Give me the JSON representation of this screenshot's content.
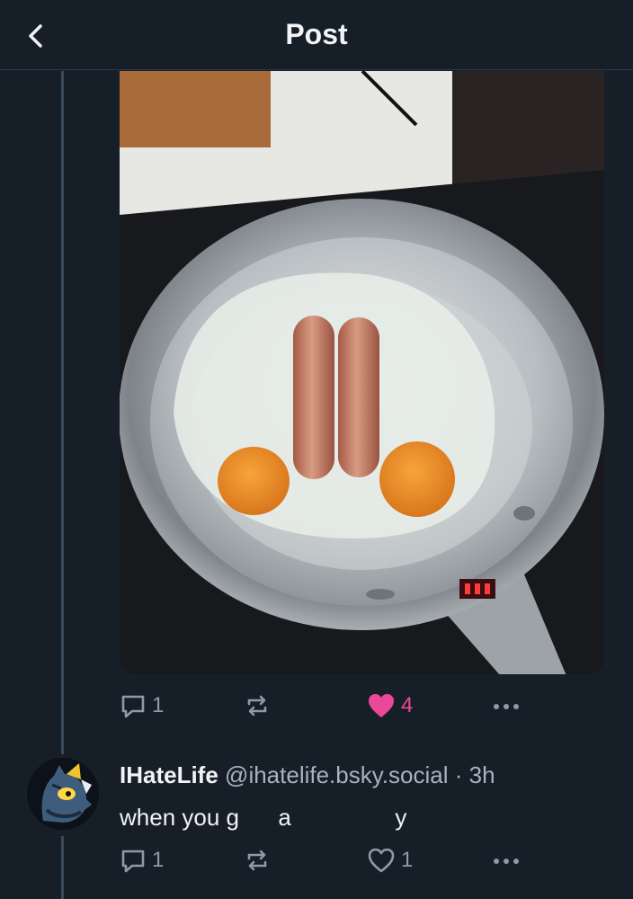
{
  "header": {
    "title": "Post",
    "back_icon": "chevron-left-icon"
  },
  "post": {
    "image_alt": "Two sausages and two eggs frying in a stainless steel pan",
    "actions": {
      "reply_count": "1",
      "repost_count": "",
      "like_count": "4",
      "liked": true,
      "like_color": "#ec4899",
      "icons": [
        "reply-icon",
        "repost-icon",
        "heart-icon",
        "more-icon"
      ]
    }
  },
  "reply": {
    "display_name": "IHateLife",
    "handle": "@ihatelife.bsky.social",
    "separator": "·",
    "time": "3h",
    "text": "when you g      a                y",
    "actions": {
      "reply_count": "1",
      "repost_count": "",
      "like_count": "1",
      "liked": false
    }
  },
  "colors": {
    "background": "#161e27",
    "text": "#f1f3f5",
    "muted": "#8c9bab",
    "thread_line": "#3b4a59"
  }
}
